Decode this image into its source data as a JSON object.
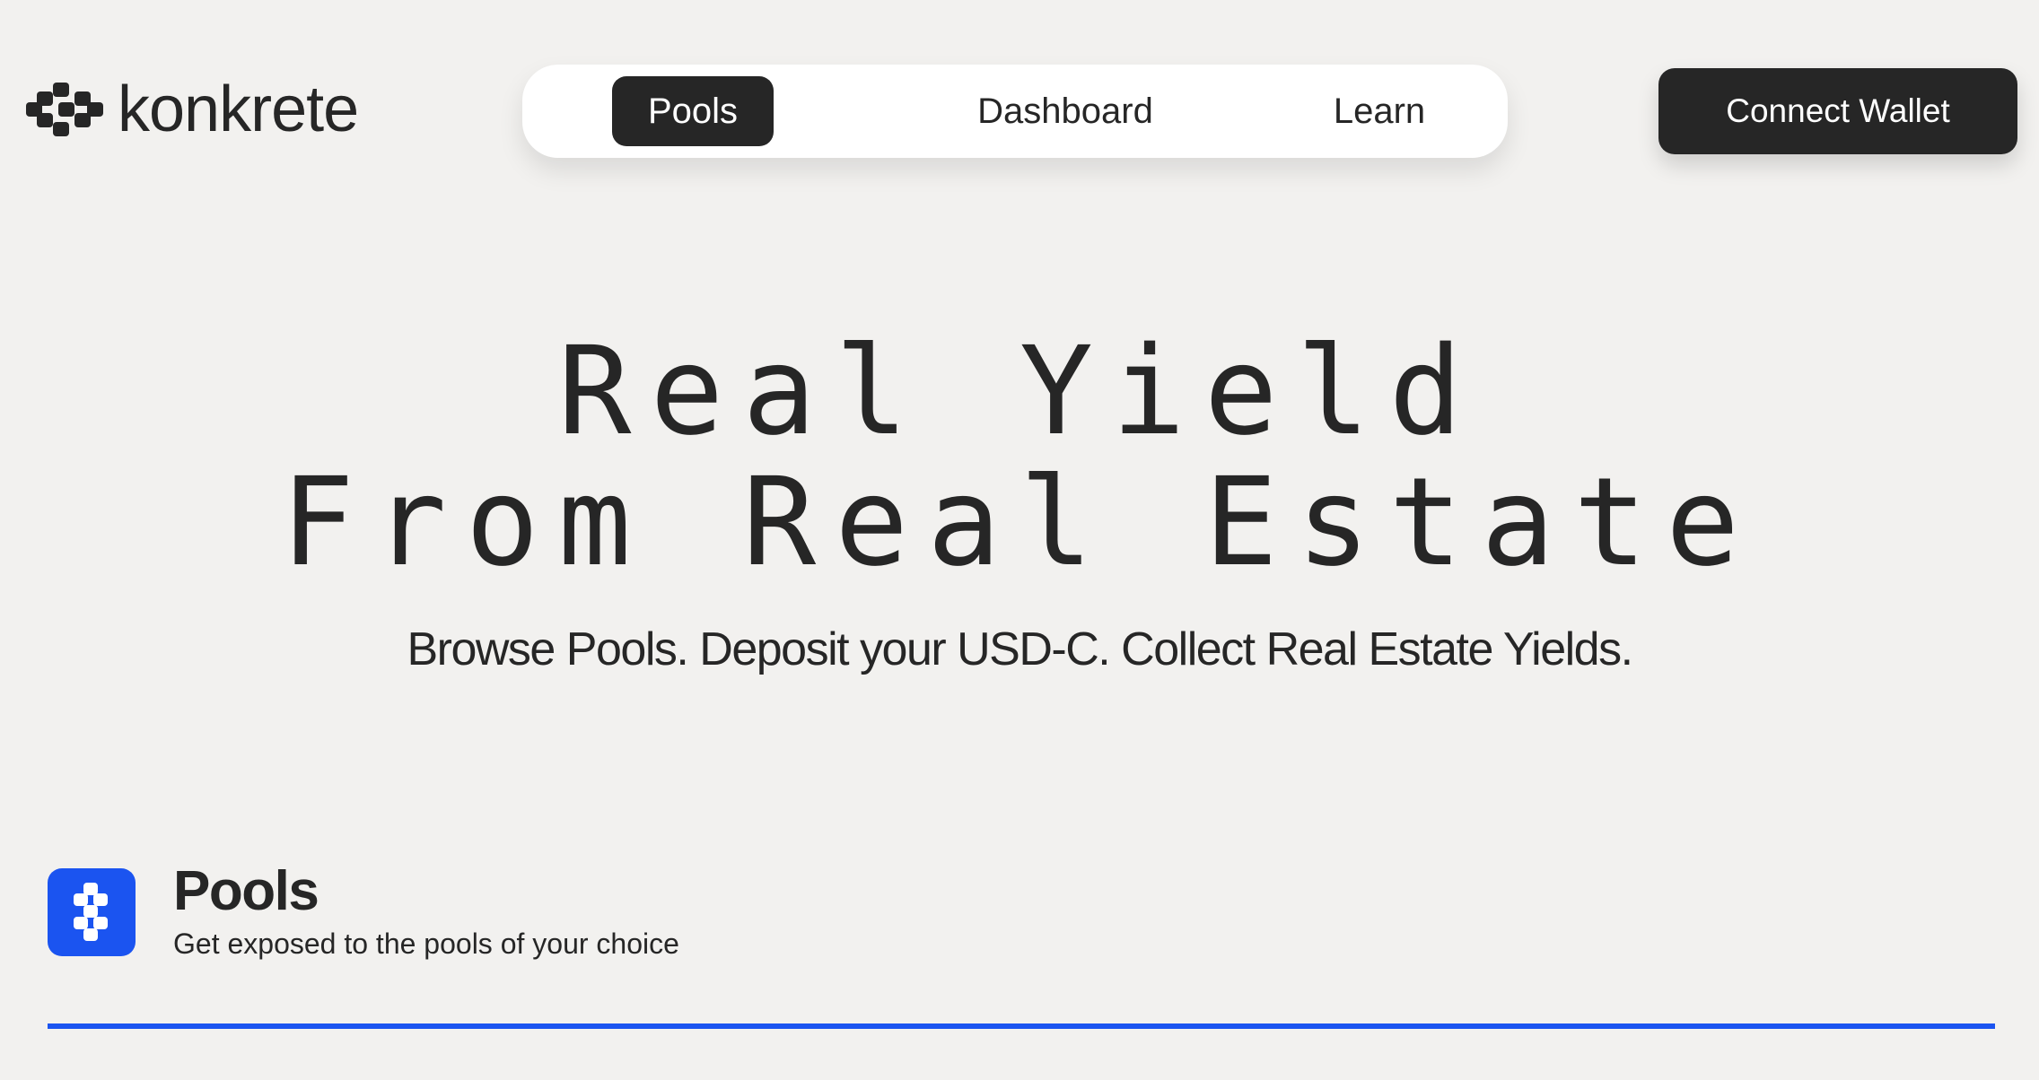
{
  "header": {
    "logo_text": "konkrete",
    "logo_icon": "konkrete-logo-icon",
    "nav": [
      {
        "label": "Pools",
        "active": true
      },
      {
        "label": "Dashboard",
        "active": false
      },
      {
        "label": "Learn",
        "active": false
      }
    ],
    "connect_label": "Connect Wallet"
  },
  "hero": {
    "title_line1": "Real Yield",
    "title_line2": "From Real Estate",
    "subtitle": "Browse Pools. Deposit your USD-C. Collect Real Estate Yields."
  },
  "pools_section": {
    "icon": "pools-icon",
    "title": "Pools",
    "subtitle": "Get exposed to the pools of your choice"
  },
  "colors": {
    "background": "#f2f1ef",
    "text": "#262626",
    "accent": "#1b54f0",
    "surface": "#ffffff"
  }
}
